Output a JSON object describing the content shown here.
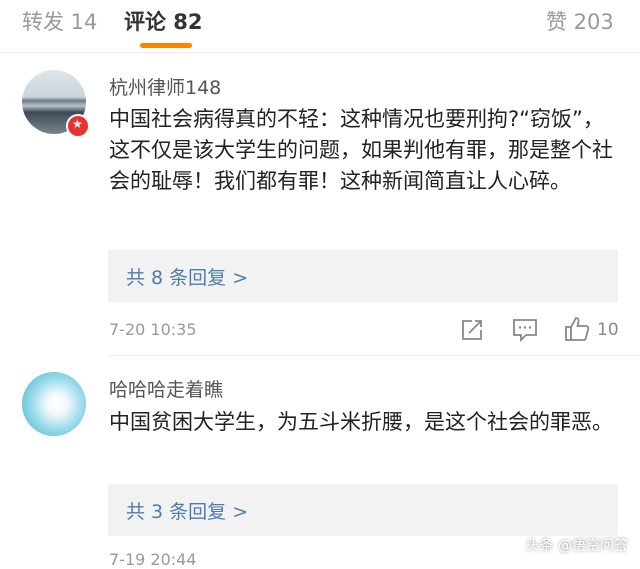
{
  "tabs": {
    "repost_label": "转发 14",
    "comment_label": "评论 82",
    "like_label": "赞 203"
  },
  "comments": [
    {
      "username": "杭州律师148",
      "text": "中国社会病得真的不轻：这种情况也要刑拘?“窃饭”，这不仅是该大学生的问题，如果判他有罪，那是整个社会的耻辱！我们都有罪！这种新闻简直让人心碎。",
      "replies_label": "共 8 条回复 >",
      "time": "7-20 10:35",
      "like_count": "10"
    },
    {
      "username": "哈哈哈走着瞧",
      "text": "中国贫困大学生，为五斗米折腰，是这个社会的罪恶。",
      "replies_label": "共 3 条回复 >",
      "time": "7-19 20:44"
    }
  ],
  "watermark": "头条 @悟空问答",
  "colors": {
    "accent": "#ff8200",
    "link": "#4f7cae",
    "badge": "#e8332e"
  }
}
